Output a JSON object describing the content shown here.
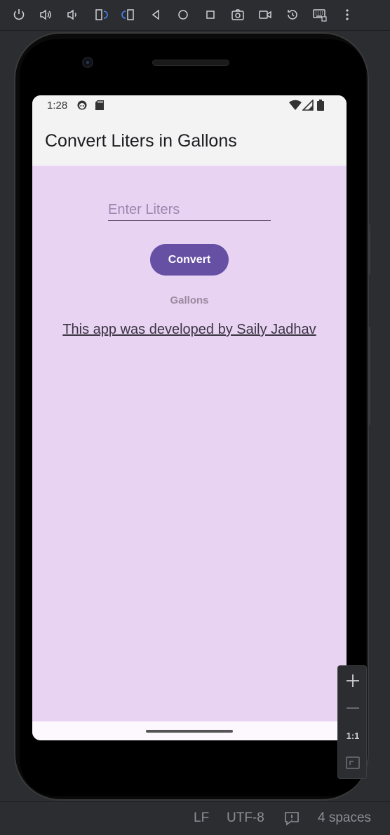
{
  "toolbar": {
    "icons": [
      "power-icon",
      "volume-up-icon",
      "volume-down-icon",
      "rotate-left-icon",
      "rotate-right-icon",
      "back-icon",
      "home-icon",
      "overview-icon",
      "screenshot-icon",
      "screen-record-icon",
      "snapshot-icon",
      "keyboard-icon",
      "more-icon"
    ]
  },
  "statusbar": {
    "time": "1:28"
  },
  "app": {
    "title": "Convert Liters in Gallons",
    "input_placeholder": "Enter Liters",
    "input_value": "",
    "convert_label": "Convert",
    "result_label": "Gallons",
    "developer_text": " This app was developed by Saily Jadhav"
  },
  "zoom": {
    "plus": "+",
    "minus": "—",
    "one_to_one": "1:1"
  },
  "ide_status": {
    "line_ending": "LF",
    "encoding": "UTF-8",
    "indent": "4 spaces"
  },
  "colors": {
    "content_bg": "#e8d3f3",
    "button_bg": "#6650a4",
    "ide_bg": "#2b2d30"
  }
}
